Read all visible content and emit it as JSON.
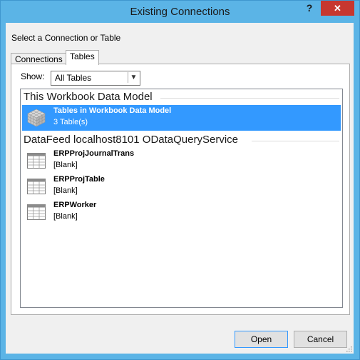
{
  "dialog": {
    "title": "Existing Connections",
    "help": "?",
    "close": "✕",
    "caption": "Select a Connection or Table"
  },
  "tabs": [
    {
      "label": "Connections",
      "active": false
    },
    {
      "label": "Tables",
      "active": true
    }
  ],
  "show": {
    "label": "Show:",
    "value": "All Tables"
  },
  "groups": [
    {
      "header": "This Workbook Data Model",
      "items": [
        {
          "name": "Tables in Workbook Data Model",
          "sub": "3 Table(s)",
          "icon": "data-model-cube-icon",
          "selected": true
        }
      ]
    },
    {
      "header": "DataFeed localhost8101 ODataQueryService",
      "items": [
        {
          "name": "ERPProjJournalTrans",
          "sub": "[Blank]",
          "icon": "table-icon",
          "selected": false
        },
        {
          "name": "ERPProjTable",
          "sub": "[Blank]",
          "icon": "table-icon",
          "selected": false
        },
        {
          "name": "ERPWorker",
          "sub": "[Blank]",
          "icon": "table-icon",
          "selected": false
        }
      ]
    }
  ],
  "buttons": {
    "open": "Open",
    "cancel": "Cancel"
  },
  "colors": {
    "frame": "#5bb4e6",
    "close": "#c7372f",
    "selection": "#3399ff"
  }
}
